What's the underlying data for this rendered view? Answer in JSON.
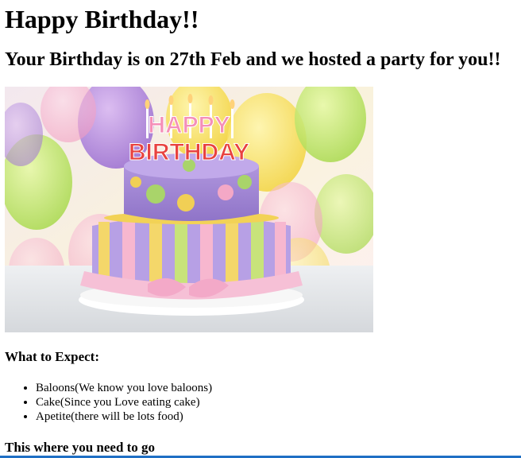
{
  "page": {
    "title": "Happy Birthday!!",
    "subtitle": "Your Birthday is on 27th Feb and we hosted a party for you!!"
  },
  "image": {
    "topper_word_1": "HAPPY",
    "topper_word_2": "BIRTHDAY"
  },
  "expect": {
    "heading": "What to Expect:",
    "items": [
      "Baloons(We know you love baloons)",
      "Cake(Since you Love eating cake)",
      "Apetite(there will be lots food)"
    ]
  },
  "directions": {
    "heading": "This where you need to go"
  },
  "colors": {
    "accent_bar": "#1f6fc4"
  }
}
